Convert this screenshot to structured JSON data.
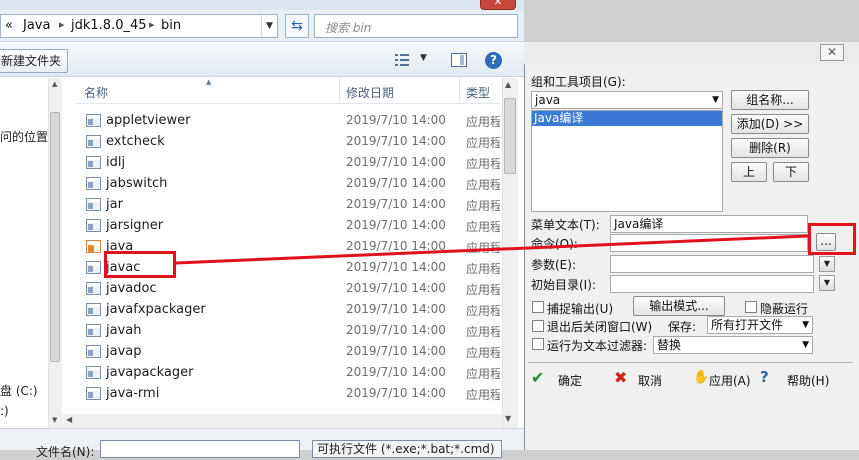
{
  "explorer": {
    "breadcrumb": [
      "«",
      "Java",
      "jdk1.8.0_45",
      "bin"
    ],
    "search_placeholder": "搜索 bin",
    "new_folder_label": "新建文件夹",
    "nav_labels": {
      "location": "问的位置",
      "drive": "盘 (C:)",
      "drive2": ":)"
    },
    "columns": {
      "name": "名称",
      "date": "修改日期",
      "type": "类型"
    },
    "files": [
      {
        "name": "appletviewer",
        "date": "2019/7/10 14:00",
        "type": "应用程",
        "icon": "exe-icon"
      },
      {
        "name": "extcheck",
        "date": "2019/7/10 14:00",
        "type": "应用程",
        "icon": "exe-icon"
      },
      {
        "name": "idlj",
        "date": "2019/7/10 14:00",
        "type": "应用程",
        "icon": "exe-icon"
      },
      {
        "name": "jabswitch",
        "date": "2019/7/10 14:00",
        "type": "应用程",
        "icon": "exe-icon"
      },
      {
        "name": "jar",
        "date": "2019/7/10 14:00",
        "type": "应用程",
        "icon": "exe-icon"
      },
      {
        "name": "jarsigner",
        "date": "2019/7/10 14:00",
        "type": "应用程",
        "icon": "exe-icon"
      },
      {
        "name": "java",
        "date": "2019/7/10 14:00",
        "type": "应用程",
        "icon": "java-icon"
      },
      {
        "name": "javac",
        "date": "2019/7/10 14:00",
        "type": "应用程",
        "icon": "exe-icon"
      },
      {
        "name": "javadoc",
        "date": "2019/7/10 14:00",
        "type": "应用程",
        "icon": "exe-icon"
      },
      {
        "name": "javafxpackager",
        "date": "2019/7/10 14:00",
        "type": "应用程",
        "icon": "exe-icon"
      },
      {
        "name": "javah",
        "date": "2019/7/10 14:00",
        "type": "应用程",
        "icon": "exe-icon"
      },
      {
        "name": "javap",
        "date": "2019/7/10 14:00",
        "type": "应用程",
        "icon": "exe-icon"
      },
      {
        "name": "javapackager",
        "date": "2019/7/10 14:00",
        "type": "应用程",
        "icon": "exe-icon"
      },
      {
        "name": "java-rmi",
        "date": "2019/7/10 14:00",
        "type": "应用程",
        "icon": "exe-icon"
      }
    ],
    "filename_label": "文件名(N):",
    "filetype_value": "可执行文件 (*.exe;*.bat;*.cmd)"
  },
  "dialog": {
    "group_label": "组和工具项目(G):",
    "group_value": "java",
    "tool_items": [
      "Java编译"
    ],
    "btn_group_name": "组名称...",
    "btn_add": "添加(D) >>",
    "btn_delete": "删除(R)",
    "btn_up": "上",
    "btn_down": "下",
    "menu_text_label": "菜单文本(T):",
    "menu_text_value": "Java编译",
    "command_label": "命令(O):",
    "command_value": "",
    "browse_label": "...",
    "args_label": "参数(E):",
    "args_value": "",
    "initdir_label": "初始目录(I):",
    "initdir_value": "",
    "capture_label": "捕捉输出(U)",
    "output_mode_label": "输出模式...",
    "hide_run_label": "隐蔽运行",
    "close_after_label": "退出后关闭窗口(W)",
    "save_label": "保存:",
    "save_value": "所有打开文件",
    "filter_label": "运行为文本过滤器:",
    "filter_value": "替换",
    "ok_label": "确定",
    "cancel_label": "取消",
    "apply_label": "应用(A)",
    "help_label": "帮助(H)"
  },
  "colors": {
    "annotation_red": "#e0121b",
    "selection_blue": "#3b79d6"
  }
}
